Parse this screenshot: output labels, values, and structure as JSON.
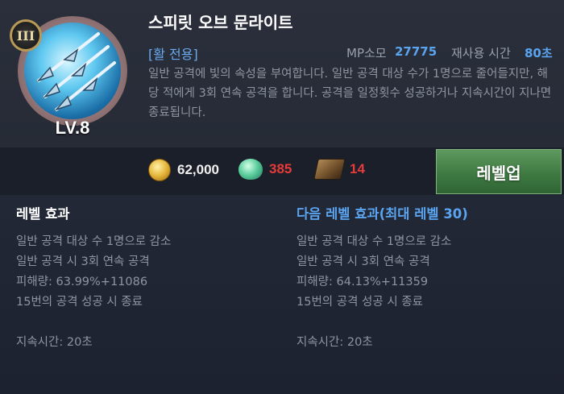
{
  "skill": {
    "name": "스피릿 오브 문라이트",
    "rank_badge": "III",
    "level": "LV.8",
    "tag": "[활 전용]",
    "mp_label": "MP소모",
    "mp_value": "27775",
    "cooldown_label": "재사용 시간",
    "cooldown_value": "80초",
    "description": "일반 공격에 빛의 속성을 부여합니다. 일반 공격 대상 수가 1명으로 줄어들지만, 해당 적에게 3회 연속 공격을 합니다. 공격을 일정횟수 성공하거나 지속시간이 지나면 종료됩니다."
  },
  "cost": {
    "gold": "62,000",
    "gem": "385",
    "book": "14",
    "icons": [
      "gold-coin-icon",
      "green-gem-icon",
      "skill-book-icon"
    ],
    "colors": {
      "gold": "#f0f0f0",
      "insufficient": "#e63b3b"
    }
  },
  "levelup_button": "레벨업",
  "current_effect": {
    "title": "레벨 효과",
    "lines": [
      "일반 공격 대상 수 1명으로 감소",
      "일반 공격 시 3회 연속 공격",
      "피해량: 63.99%+11086",
      "15번의 공격 성공 시 종료",
      "",
      "지속시간: 20초"
    ]
  },
  "next_effect": {
    "title": "다음 레벨 효과(최대 레벨 30)",
    "lines": [
      "일반 공격 대상 수 1명으로 감소",
      "일반 공격 시 3회 연속 공격",
      "피해량: 64.13%+11359",
      "15번의 공격 성공 시 종료",
      "",
      "지속시간: 20초"
    ]
  },
  "colors": {
    "accent_blue": "#5aa4f0",
    "button_green": "#3f7a42",
    "background": "#1e2330"
  }
}
